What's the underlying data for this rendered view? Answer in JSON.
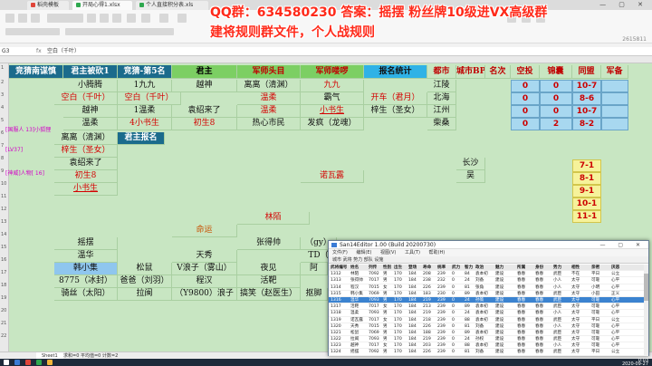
{
  "browser_tabs": [
    {
      "label": "稻壳模板",
      "color": "#e0453a"
    },
    {
      "label": "开局心得1.xlsx",
      "color": "#2fa84f"
    },
    {
      "label": "个人直接积分表.xls",
      "color": "#2fa84f"
    }
  ],
  "headline": {
    "line1": "QQ群：634580230 答案：摇摆  粉丝牌10级进VX高级群",
    "line2": "建将规则群文件，个人战规则"
  },
  "corner_code": "2615811",
  "formula": {
    "cell": "G3",
    "fx": "fx",
    "value": "空白（千叶）"
  },
  "row_numbers": [
    "1",
    "2",
    "3",
    "4",
    "5",
    "6",
    "7",
    "8",
    "9",
    "10",
    "11",
    "12",
    "13",
    "14",
    "15",
    "16",
    "17",
    "18",
    "19",
    "20",
    "21",
    "22",
    "23"
  ],
  "header": {
    "c1": "竞猜南谋慎",
    "c2": "君主被砍1",
    "c3": "竞猜-第5名",
    "c4": "君主",
    "c5": "军师头目",
    "c6": "军师喽啰",
    "c7": "报名统计",
    "c8": "都市",
    "c9": "城市BP",
    "c10": "名次",
    "c11": "空投",
    "c12": "锦囊",
    "c13": "同盟",
    "c14": "军备"
  },
  "grid": {
    "r2": {
      "a": "小腾腾",
      "b": "1九九",
      "c": "越神",
      "d": "离离（清渊）",
      "e": "九九",
      "city": "江陵"
    },
    "r3": {
      "a": "空白（千叶）",
      "b": "空白（千叶）",
      "c": "",
      "d": "温柔",
      "e": "霸气",
      "f": "开车（君月）",
      "city": "北海"
    },
    "r4": {
      "a": "越神",
      "b": "1温柔",
      "c": "袁绍来了",
      "d": "温柔",
      "e": "小书生",
      "f": "梓生（圣女）",
      "city": "江州"
    },
    "r5": {
      "a": "温柔",
      "b": "4小书生",
      "c": "初生8",
      "d": "热心市民",
      "e": "发疯（龙魂）",
      "city": "柴桑"
    },
    "r6": {
      "a": "离离（清渊）",
      "b": "君主报名"
    },
    "r7": {
      "a": "梓生（圣女）"
    },
    "r8": {
      "a": "袁绍来了",
      "city": "长沙"
    },
    "r9": {
      "a": "初生8",
      "e": "诺瓦露",
      "city": "吴"
    },
    "r10": {
      "a": "小书生"
    },
    "r16": {
      "d": "林陌"
    },
    "r18": {
      "c": "命运"
    },
    "r19": {
      "a": "摇摆",
      "d": "张得帅",
      "e": "（gy）"
    },
    "r20": {
      "a": "温华",
      "c": "天秀",
      "e": "TD（"
    },
    "r21": {
      "a": "韩小集",
      "b": "松鼠",
      "c": "V浪子（雾山）",
      "d": "夜见",
      "e": "阿"
    },
    "r22": {
      "a": "8775（冰封）",
      "b": "爸爸（刘羽）",
      "c": "程汉",
      "d": "活靶"
    },
    "r23": {
      "a": "骑丝（太阳）",
      "b": "拉闽",
      "c": "（Y9800）浪子",
      "d": "搞笑（赵医生）",
      "e": "抠脚"
    }
  },
  "stats": [
    {
      "a": "0",
      "b": "0",
      "c": "10-7"
    },
    {
      "a": "0",
      "b": "0",
      "c": "8-6"
    },
    {
      "a": "0",
      "b": "0",
      "c": "10-7"
    },
    {
      "a": "0",
      "b": "2",
      "c": "8-2"
    }
  ],
  "yellow": [
    "7-1",
    "8-1",
    "9-1",
    "10-1",
    "11-1"
  ],
  "chat": [
    "[国服人 13]小狐狸",
    "[LV37]",
    "[神威]人物[ 16]"
  ],
  "sheet": {
    "tab": "Sheet1",
    "status": "求和=0  平均值=0  计数=2"
  },
  "clock": {
    "time": "0:03",
    "date": "2020-09-27"
  },
  "editor": {
    "title": "San14Editor 1.00 (Build 20200730)",
    "menu": [
      "文件(F)",
      "编辑(E)",
      "视图(V)",
      "工具(T)",
      "帮助(H)"
    ],
    "toolbar": "城市  武将  势力  部队  设施",
    "columns": [
      "武将编号",
      "姓名",
      "列传",
      "性别",
      "出生",
      "登场",
      "寿命",
      "统率",
      "武力",
      "智力",
      "政治",
      "魅力",
      "所属",
      "身份",
      "势力",
      "相性",
      "亲密",
      "厌恶"
    ],
    "rows": [
      [
        "1312",
        "林陌",
        "7092",
        "男",
        "170",
        "184",
        "208",
        "239",
        "0",
        "84",
        "袁本初",
        "建设",
        "春春",
        "春春",
        "武臣",
        "不在",
        "平日",
        "公立"
      ],
      [
        "1313",
        "张得帅",
        "7017",
        "男",
        "170",
        "184",
        "238",
        "232",
        "0",
        "24",
        "刘备",
        "建设",
        "春春",
        "春春",
        "小人",
        "太守",
        "可靠",
        "心平"
      ],
      [
        "1314",
        "程汉",
        "7015",
        "女",
        "170",
        "184",
        "226",
        "239",
        "0",
        "81",
        "张角",
        "建设",
        "春春",
        "春春",
        "小人",
        "太守",
        "小明",
        "心平"
      ],
      [
        "1315",
        "韩小集",
        "7069",
        "男",
        "170",
        "184",
        "183",
        "230",
        "0",
        "89",
        "袁本初",
        "建设",
        "春春",
        "春春",
        "武臣",
        "太守",
        "小田",
        "正义"
      ],
      [
        "1316",
        "温华",
        "7093",
        "男",
        "170",
        "184",
        "219",
        "239",
        "0",
        "24",
        "孙策",
        "建设",
        "春春",
        "春春",
        "武臣",
        "太守",
        "可靠",
        "心平"
      ],
      [
        "1317",
        "活靶",
        "7017",
        "女",
        "170",
        "184",
        "213",
        "239",
        "0",
        "89",
        "袁本初",
        "建设",
        "春春",
        "春春",
        "武臣",
        "太守",
        "可靠",
        "心平"
      ],
      [
        "1318",
        "温柔",
        "7093",
        "男",
        "170",
        "184",
        "219",
        "239",
        "0",
        "24",
        "袁本初",
        "建设",
        "春春",
        "春春",
        "小人",
        "太守",
        "可靠",
        "心平"
      ],
      [
        "1319",
        "诺瓦露",
        "7017",
        "女",
        "170",
        "184",
        "218",
        "239",
        "0",
        "88",
        "袁本初",
        "建设",
        "春春",
        "春春",
        "武臣",
        "太守",
        "平日",
        "公立"
      ],
      [
        "1320",
        "天秀",
        "7015",
        "男",
        "170",
        "184",
        "226",
        "239",
        "0",
        "81",
        "刘备",
        "建设",
        "春春",
        "春春",
        "小人",
        "太守",
        "可靠",
        "心平"
      ],
      [
        "1321",
        "松鼠",
        "7069",
        "男",
        "170",
        "184",
        "188",
        "239",
        "0",
        "89",
        "袁本初",
        "建设",
        "春春",
        "春春",
        "武臣",
        "太守",
        "可靠",
        "心平"
      ],
      [
        "1322",
        "拉闽",
        "7093",
        "男",
        "170",
        "184",
        "219",
        "239",
        "0",
        "24",
        "孙权",
        "建设",
        "春春",
        "春春",
        "武臣",
        "太守",
        "可靠",
        "心平"
      ],
      [
        "1323",
        "越神",
        "7017",
        "女",
        "170",
        "184",
        "203",
        "239",
        "0",
        "88",
        "袁本初",
        "建设",
        "春春",
        "春春",
        "小人",
        "太守",
        "可靠",
        "心平"
      ],
      [
        "1324",
        "摇摆",
        "7092",
        "男",
        "170",
        "184",
        "226",
        "239",
        "0",
        "81",
        "刘备",
        "建设",
        "春春",
        "春春",
        "武臣",
        "太守",
        "平日",
        "公立"
      ]
    ],
    "selected_row": 4
  }
}
